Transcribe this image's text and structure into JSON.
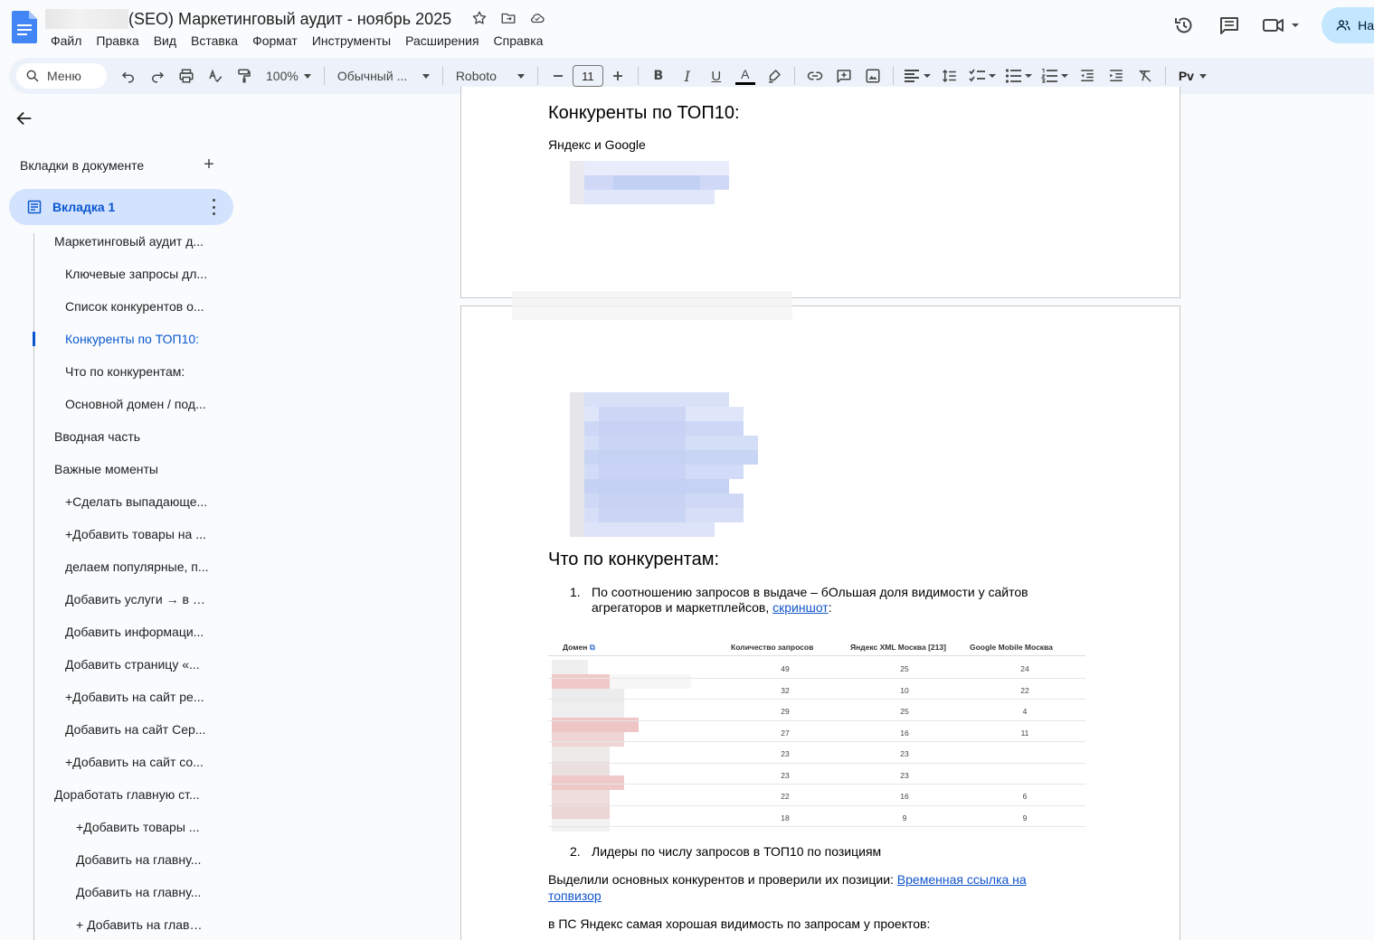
{
  "titlebar": {
    "doc_title": "(SEO) Маркетинговый аудит - ноябрь 2025",
    "menu": [
      "Файл",
      "Правка",
      "Вид",
      "Вставка",
      "Формат",
      "Инструменты",
      "Расширения",
      "Справка"
    ],
    "share_label": "На"
  },
  "toolbar": {
    "search_label": "Меню",
    "zoom": "100%",
    "style": "Обычный ...",
    "font": "Roboto",
    "font_size": "11",
    "bold": "B",
    "italic": "I",
    "underline": "U",
    "text_color": "A",
    "spell": "Pv"
  },
  "sidebar": {
    "tabs_title": "Вкладки в документе",
    "active_tab": "Вкладка 1",
    "outline": [
      {
        "label": "Маркетинговый аудит д...",
        "level": 1
      },
      {
        "label": "Ключевые запросы дл...",
        "level": 2
      },
      {
        "label": "Список конкурентов о...",
        "level": 2
      },
      {
        "label": "Конкуренты по ТОП10:",
        "level": 2,
        "active": true
      },
      {
        "label": "Что по конкурентам:",
        "level": 2
      },
      {
        "label": "Основной домен / под...",
        "level": 2
      },
      {
        "label": "Вводная часть",
        "level": 1
      },
      {
        "label": "Важные моменты",
        "level": 1
      },
      {
        "label": "+Сделать выпадающе...",
        "level": 2
      },
      {
        "label": "+Добавить товары на ...",
        "level": 2
      },
      {
        "label": "делаем популярные, п...",
        "level": 2
      },
      {
        "label": "Добавить услуги → в п...",
        "level": 2
      },
      {
        "label": "Добавить информаци...",
        "level": 2
      },
      {
        "label": "Добавить страницу «...",
        "level": 2
      },
      {
        "label": "+Добавить на сайт ре...",
        "level": 2
      },
      {
        "label": "Добавить на сайт Сер...",
        "level": 2
      },
      {
        "label": "+Добавить на сайт со...",
        "level": 2
      },
      {
        "label": "Доработать главную ст...",
        "level": 1
      },
      {
        "label": "+Добавить товары ...",
        "level": 3
      },
      {
        "label": "Добавить на главну...",
        "level": 3
      },
      {
        "label": "Добавить на главну...",
        "level": 3
      },
      {
        "label": "+ Добавить на главн...",
        "level": 3
      }
    ]
  },
  "document": {
    "h_top10": "Конкуренты по ТОП10:",
    "p_engines": "Яндекс и Google",
    "h_competitors": "Что по конкурентам:",
    "li1_num": "1.",
    "li1_text": "По соотношению запросов в выдаче – бОльшая доля видимости у сайтов агрегаторов и маркетплейсов, ",
    "li1_link": "скриншот",
    "li1_tail": ":",
    "li2_num": "2.",
    "li2_text": "Лидеры по числу запросов в ТОП10 по позициям",
    "p_selected": "Выделили основных конкурентов и проверили их позиции: ",
    "p_selected_link": "Временная ссылка на топвизор",
    "p_yandex": "в ПС Яндекс самая хорошая видимость по запросам у проектов:"
  },
  "screenshot_table": {
    "headers": [
      "Домен",
      "Количество запросов",
      "Яндекс XML Москва [213]",
      "Google Mobile Москва"
    ],
    "rows": [
      [
        "49",
        "25",
        "24"
      ],
      [
        "32",
        "10",
        "22"
      ],
      [
        "29",
        "25",
        "4"
      ],
      [
        "27",
        "16",
        "11"
      ],
      [
        "23",
        "23",
        ""
      ],
      [
        "23",
        "23",
        ""
      ],
      [
        "22",
        "16",
        "6"
      ],
      [
        "18",
        "9",
        "9"
      ]
    ]
  },
  "colors": {
    "accent": "#0b57d0",
    "active_tab_bg": "#d3e3fd",
    "toolbar_bg": "#edf2fa",
    "share_bg": "#c2e7ff",
    "link": "#1155cc"
  }
}
